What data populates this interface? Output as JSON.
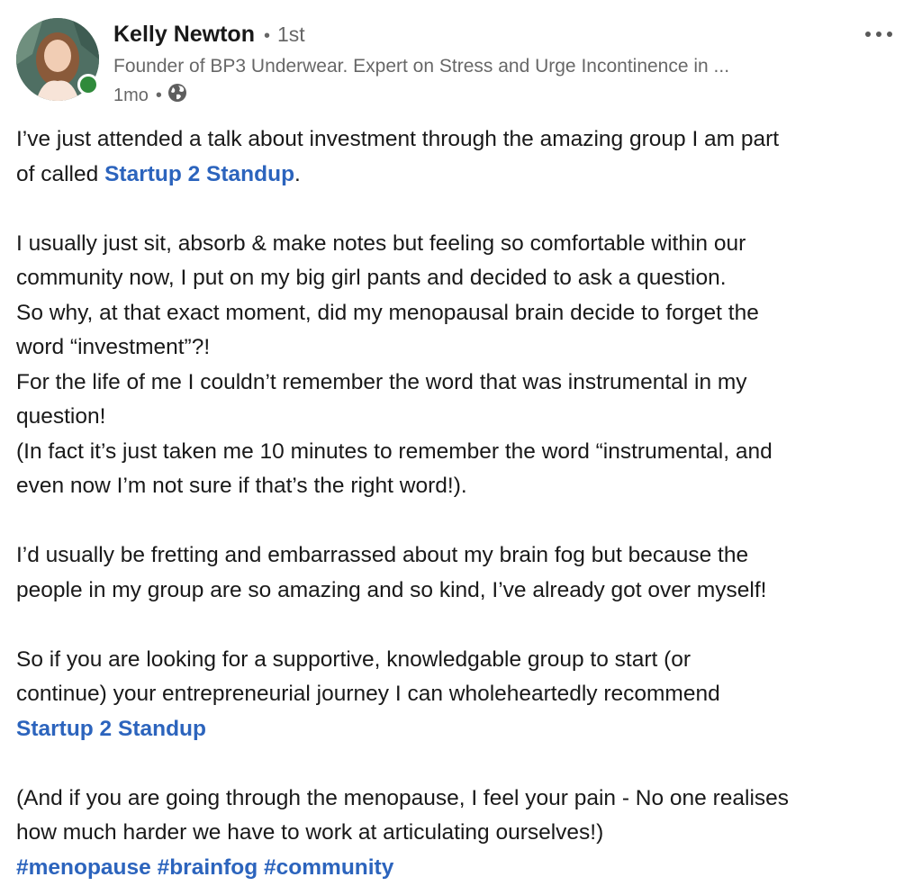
{
  "author": {
    "name": "Kelly Newton",
    "degree": "1st",
    "headline": "Founder of BP3 Underwear. Expert on Stress and Urge Incontinence in ...",
    "time": "1mo",
    "visibility_icon": "globe-icon",
    "online": true
  },
  "post": {
    "l1": "I’ve just attended a talk about investment through the amazing group I am part",
    "l2_pre": "of called ",
    "l2_link": "Startup 2 Standup",
    "l2_post": ".",
    "l3": "I usually just sit, absorb & make notes but feeling so comfortable within our",
    "l4": "community now, I put on my big girl pants and decided to ask a question.",
    "l5": "So why, at that exact moment, did my menopausal brain decide to forget the",
    "l6": "word “investment”?!",
    "l7": "For the life of me I couldn’t remember the word that was instrumental in my",
    "l8": "question!",
    "l9": "(In fact it’s just taken me 10 minutes to remember the word “instrumental, and",
    "l10": "even now I’m not sure if that’s the right word!).",
    "l11": "I’d usually be fretting and embarrassed about my brain fog but because the",
    "l12": "people in my group are so amazing and so kind, I’ve already got over myself!",
    "l13": "So if you are looking for a supportive, knowledgable group to start (or",
    "l14": "continue) your entrepreneurial journey I can wholeheartedly recommend",
    "l15_link": "Startup 2 Standup",
    "l16": "(And if you are going through the menopause, I feel your pain - No one realises",
    "l17": "how much harder we have to work at articulating ourselves!)",
    "hashtags": [
      "#menopause",
      "#brainfog",
      "#community"
    ]
  },
  "colors": {
    "link": "#2c64bd",
    "presence": "#2f8a3b",
    "secondary_text": "#666666"
  }
}
